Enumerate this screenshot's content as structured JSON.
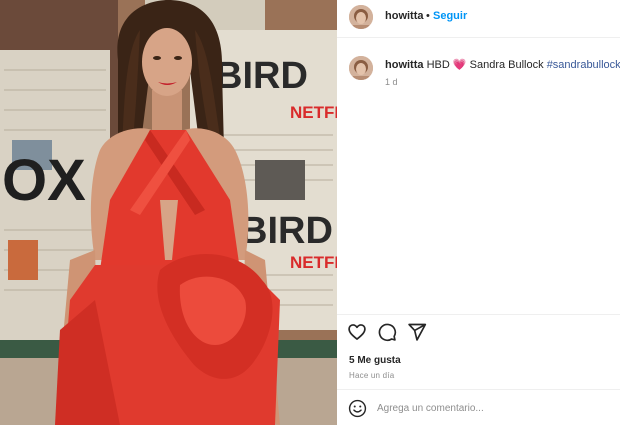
{
  "post": {
    "username": "howitta",
    "separator": "•",
    "follow_label": "Seguir",
    "caption": {
      "username": "howitta",
      "text_before": "HBD",
      "heart_emoji": "💗",
      "text_after": "Sandra Bullock",
      "hashtag": "#sandrabullock",
      "age": "1 d"
    },
    "likes": "5 Me gusta",
    "posted": "Hace un día",
    "comment_placeholder": "Agrega un comentario...",
    "icons": {
      "like": "heart-outline-icon",
      "comment": "comment-bubble-icon",
      "share": "paper-plane-icon",
      "emoji": "smiley-face-icon"
    }
  },
  "photo": {
    "backdrop_text": [
      "BIRD",
      "NETFLIX",
      "OX",
      "BIRD",
      "NETFLIX"
    ],
    "dress_color": "#e2392d"
  },
  "colors": {
    "link_blue": "#0095f6",
    "hashtag": "#385898",
    "muted": "#8e8e8e"
  }
}
